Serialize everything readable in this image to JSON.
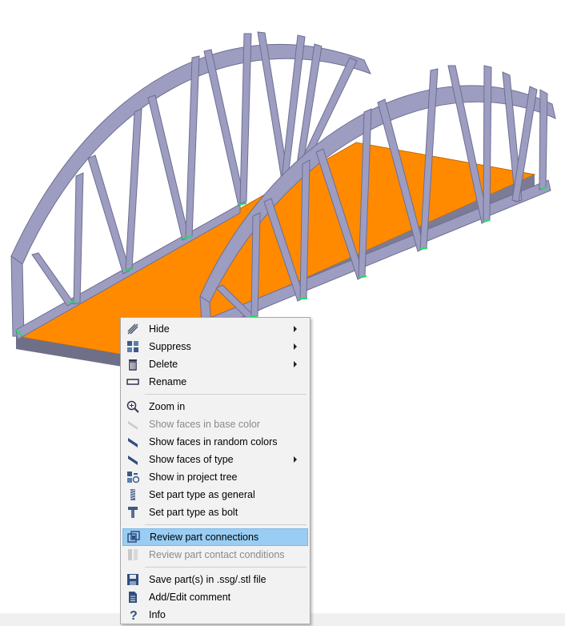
{
  "menu": {
    "items": [
      {
        "label": "Hide",
        "icon": "hide-icon",
        "submenu": true,
        "enabled": true
      },
      {
        "label": "Suppress",
        "icon": "suppress-icon",
        "submenu": true,
        "enabled": true
      },
      {
        "label": "Delete",
        "icon": "trash-icon",
        "submenu": true,
        "enabled": true
      },
      {
        "label": "Rename",
        "icon": "rename-icon",
        "submenu": false,
        "enabled": true
      },
      {
        "label": "Zoom in",
        "icon": "zoom-in-icon",
        "submenu": false,
        "enabled": true
      },
      {
        "label": "Show faces in base color",
        "icon": "base-color-faces-icon",
        "submenu": false,
        "enabled": false
      },
      {
        "label": "Show faces in random colors",
        "icon": "random-color-faces-icon",
        "submenu": false,
        "enabled": true
      },
      {
        "label": "Show faces of type",
        "icon": "face-type-icon",
        "submenu": true,
        "enabled": true
      },
      {
        "label": "Show in project tree",
        "icon": "project-tree-icon",
        "submenu": false,
        "enabled": true
      },
      {
        "label": "Set part type as general",
        "icon": "general-part-icon",
        "submenu": false,
        "enabled": true
      },
      {
        "label": "Set part type as bolt",
        "icon": "bolt-icon",
        "submenu": false,
        "enabled": true
      },
      {
        "label": "Review part connections",
        "icon": "connections-icon",
        "submenu": false,
        "enabled": true,
        "highlighted": true
      },
      {
        "label": "Review part contact conditions",
        "icon": "contact-conditions-icon",
        "submenu": false,
        "enabled": false
      },
      {
        "label": "Save part(s) in .ssg/.stl file",
        "icon": "save-icon",
        "submenu": false,
        "enabled": true
      },
      {
        "label": "Add/Edit comment",
        "icon": "comment-icon",
        "submenu": false,
        "enabled": true
      },
      {
        "label": "Info",
        "icon": "question-icon",
        "submenu": false,
        "enabled": true
      }
    ]
  },
  "colors": {
    "beam": "#9d9dc2",
    "beam_dark": "#7a7aa0",
    "deck": "#ff8a00",
    "deck_edge": "#6f6f88",
    "connection": "#22dd66",
    "menu_bg": "#f2f2f2",
    "highlight": "#99cdf3"
  }
}
